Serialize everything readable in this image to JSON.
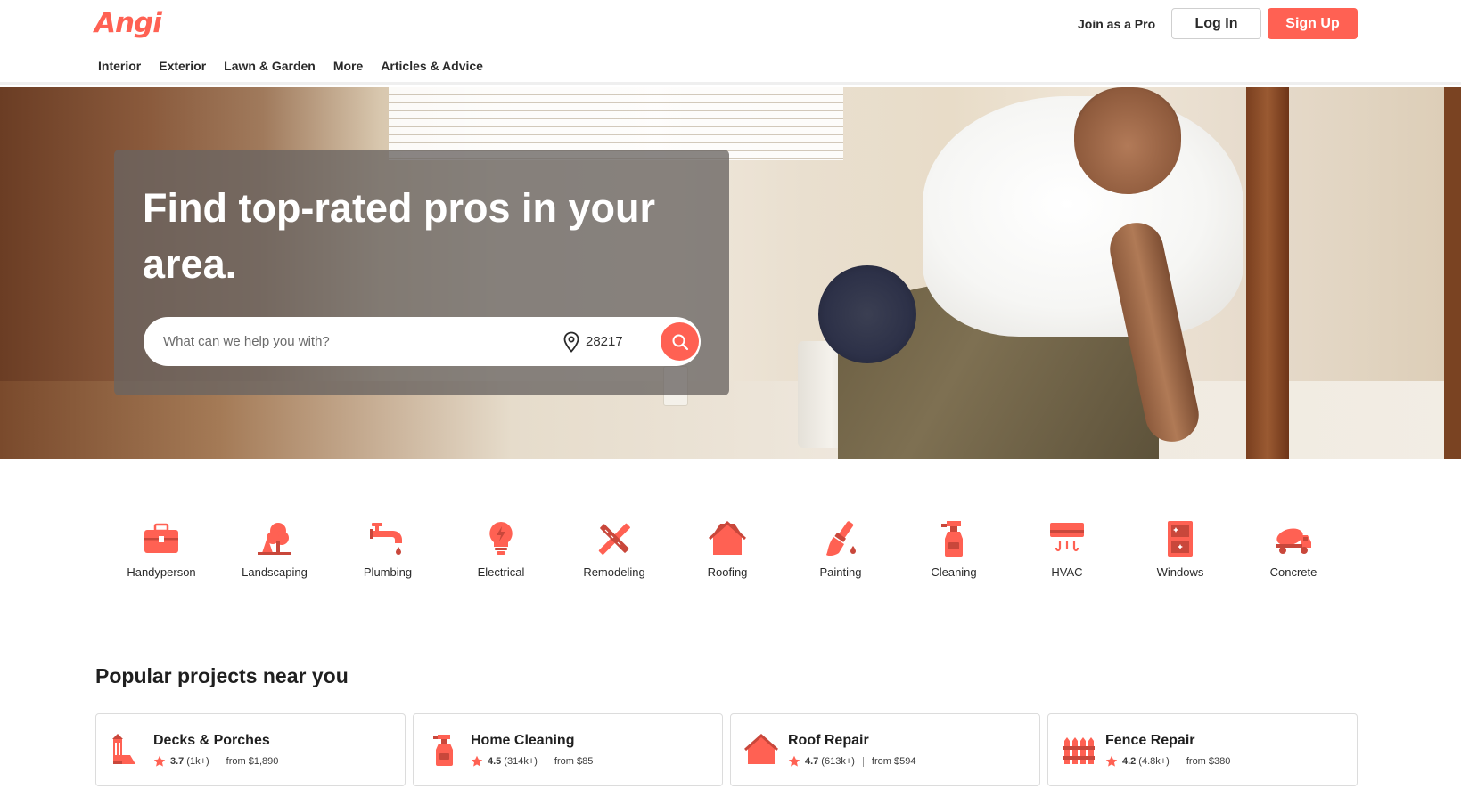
{
  "brand": {
    "logo_text": "Angi",
    "accent": "#ff6153"
  },
  "nav": {
    "items": [
      "Interior",
      "Exterior",
      "Lawn & Garden",
      "More",
      "Articles & Advice"
    ]
  },
  "header": {
    "join_pro": "Join as a Pro",
    "login": "Log In",
    "signup": "Sign Up"
  },
  "hero": {
    "title": "Find top-rated pros in your area.",
    "search_placeholder": "What can we help you with?",
    "zip": "28217",
    "pin_icon": "map-pin-icon",
    "search_icon": "search-icon"
  },
  "categories": [
    {
      "label": "Handyperson",
      "icon": "toolbox-icon"
    },
    {
      "label": "Landscaping",
      "icon": "tree-icon"
    },
    {
      "label": "Plumbing",
      "icon": "faucet-icon"
    },
    {
      "label": "Electrical",
      "icon": "lightbulb-icon"
    },
    {
      "label": "Remodeling",
      "icon": "ruler-pencil-icon"
    },
    {
      "label": "Roofing",
      "icon": "house-roof-icon"
    },
    {
      "label": "Painting",
      "icon": "paintbrush-icon"
    },
    {
      "label": "Cleaning",
      "icon": "spray-bottle-icon"
    },
    {
      "label": "HVAC",
      "icon": "air-conditioner-icon"
    },
    {
      "label": "Windows",
      "icon": "window-icon"
    },
    {
      "label": "Concrete",
      "icon": "cement-mixer-icon"
    }
  ],
  "popular": {
    "title": "Popular projects near you",
    "projects": [
      {
        "name": "Decks & Porches",
        "rating": "3.7",
        "reviews": "(1k+)",
        "price": "from $1,890",
        "icon": "deck-icon"
      },
      {
        "name": "Home Cleaning",
        "rating": "4.5",
        "reviews": "(314k+)",
        "price": "from $85",
        "icon": "spray-bottle-icon"
      },
      {
        "name": "Roof Repair",
        "rating": "4.7",
        "reviews": "(613k+)",
        "price": "from $594",
        "icon": "house-roof-icon"
      },
      {
        "name": "Fence Repair",
        "rating": "4.2",
        "reviews": "(4.8k+)",
        "price": "from $380",
        "icon": "fence-icon"
      }
    ]
  }
}
